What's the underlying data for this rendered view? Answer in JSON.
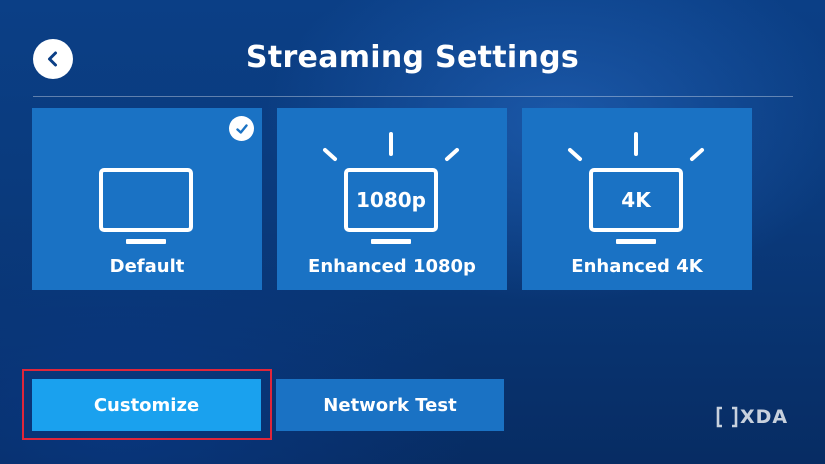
{
  "header": {
    "title": "Streaming Settings",
    "back_icon": "chevron-left-icon"
  },
  "presets": [
    {
      "label": "Default",
      "screen_text": "",
      "selected": true
    },
    {
      "label": "Enhanced 1080p",
      "screen_text": "1080p",
      "selected": false
    },
    {
      "label": "Enhanced 4K",
      "screen_text": "4K",
      "selected": false
    }
  ],
  "actions": {
    "customize_label": "Customize",
    "network_test_label": "Network Test"
  },
  "watermark": {
    "text": "XDA"
  },
  "colors": {
    "background": "#0a3a7c",
    "tile": "#1a72c4",
    "accent_button": "#1aa1ee",
    "highlight": "#e0263a"
  }
}
